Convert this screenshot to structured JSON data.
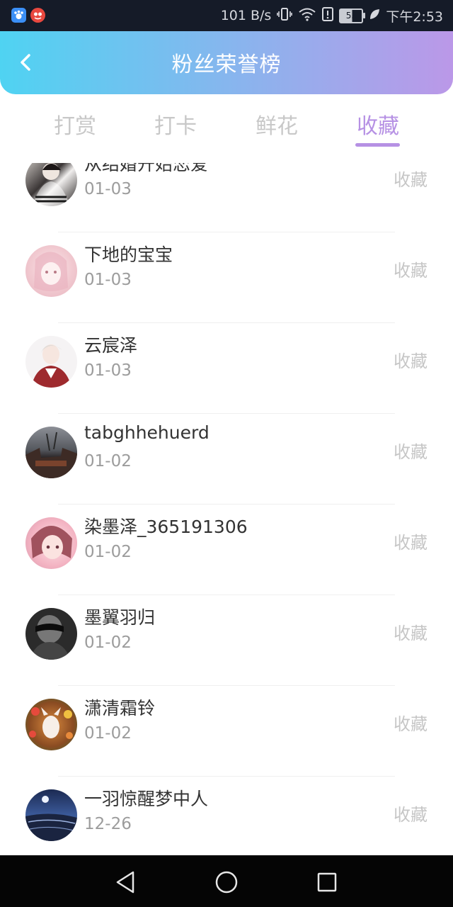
{
  "status": {
    "speed": "101 B/s",
    "battery": "55",
    "time": "下午2:53",
    "icons": [
      "baidu-icon",
      "app-icon",
      "vibrate-icon",
      "wifi-icon",
      "alert-icon",
      "battery-icon",
      "leaf-icon"
    ]
  },
  "header": {
    "title": "粉丝荣誉榜",
    "back_icon": "chevron-left-icon"
  },
  "tabs": [
    {
      "label": "打赏",
      "active": false
    },
    {
      "label": "打卡",
      "active": false
    },
    {
      "label": "鲜花",
      "active": false
    },
    {
      "label": "收藏",
      "active": true
    }
  ],
  "colors": {
    "accent": "#b691e4",
    "header_start": "#4fd3f2",
    "header_end": "#bb98e8"
  },
  "list": [
    {
      "name": "从结婚开始恋爱",
      "date": "01-03",
      "tag": "收藏"
    },
    {
      "name": "下地的宝宝",
      "date": "01-03",
      "tag": "收藏"
    },
    {
      "name": "云宸泽",
      "date": "01-03",
      "tag": "收藏"
    },
    {
      "name": "tabghhehuerd",
      "date": "01-02",
      "tag": "收藏"
    },
    {
      "name": "染墨泽_365191306",
      "date": "01-02",
      "tag": "收藏"
    },
    {
      "name": "墨翼羽归",
      "date": "01-02",
      "tag": "收藏"
    },
    {
      "name": "潇清霜铃",
      "date": "01-02",
      "tag": "收藏"
    },
    {
      "name": "一羽惊醒梦中人",
      "date": "12-26",
      "tag": "收藏"
    }
  ],
  "nav": {
    "back": "back-icon",
    "home": "home-icon",
    "recents": "recents-icon"
  }
}
